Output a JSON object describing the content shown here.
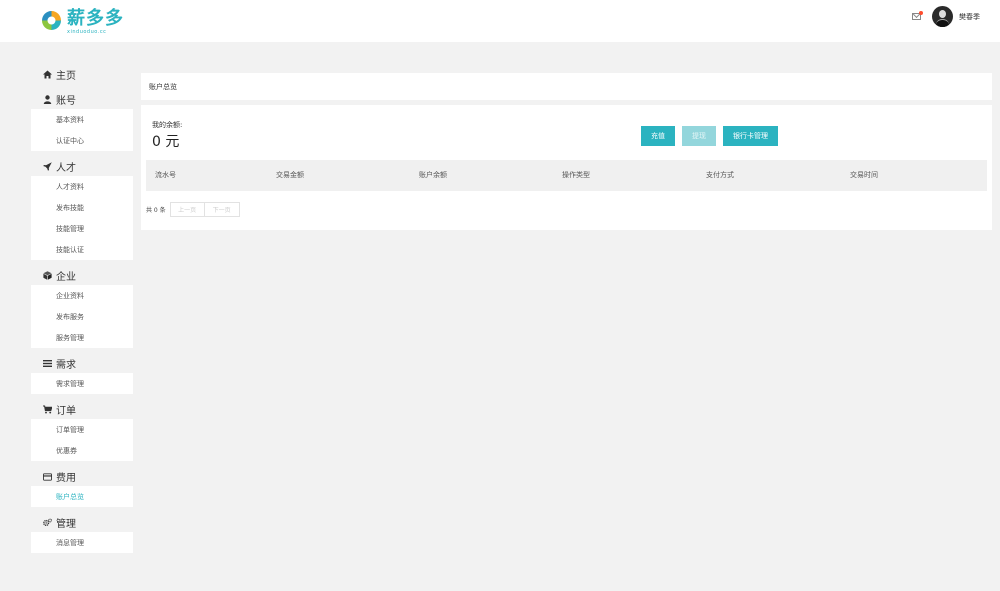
{
  "header": {
    "logo_text": "薪多多",
    "logo_sub": "xinduoduo.cc",
    "username": "樊春季"
  },
  "sidebar": {
    "groups": [
      {
        "title": "主页",
        "icon": "home-icon",
        "items": []
      },
      {
        "title": "账号",
        "icon": "user-icon",
        "items": [
          "基本资料",
          "认证中心"
        ]
      },
      {
        "title": "人才",
        "icon": "rocket-icon",
        "items": [
          "人才资料",
          "发布技能",
          "技能管理",
          "技能认证"
        ]
      },
      {
        "title": "企业",
        "icon": "cube-icon",
        "items": [
          "企业资料",
          "发布服务",
          "服务管理"
        ]
      },
      {
        "title": "需求",
        "icon": "list-icon",
        "items": [
          "需求管理"
        ]
      },
      {
        "title": "订单",
        "icon": "cart-icon",
        "items": [
          "订单管理",
          "优惠券"
        ]
      },
      {
        "title": "费用",
        "icon": "credit-card-icon",
        "items": [
          "账户总览"
        ]
      },
      {
        "title": "管理",
        "icon": "gears-icon",
        "items": [
          "消息管理"
        ]
      }
    ],
    "active_item": "账户总览"
  },
  "breadcrumb": "账户总览",
  "account": {
    "balance_label": "我的余额:",
    "balance_value": "0 元",
    "buttons": {
      "recharge": "充值",
      "withdraw": "提现",
      "bank_card": "银行卡管理"
    }
  },
  "table": {
    "columns": [
      "流水号",
      "交易金额",
      "账户余额",
      "操作类型",
      "支付方式",
      "交易时间"
    ],
    "rows": []
  },
  "pager": {
    "count_text": "共 0 条",
    "prev": "上一页",
    "next": "下一页"
  },
  "colors": {
    "accent": "#2bb3c0",
    "notification_dot": "#ff4d2e"
  }
}
